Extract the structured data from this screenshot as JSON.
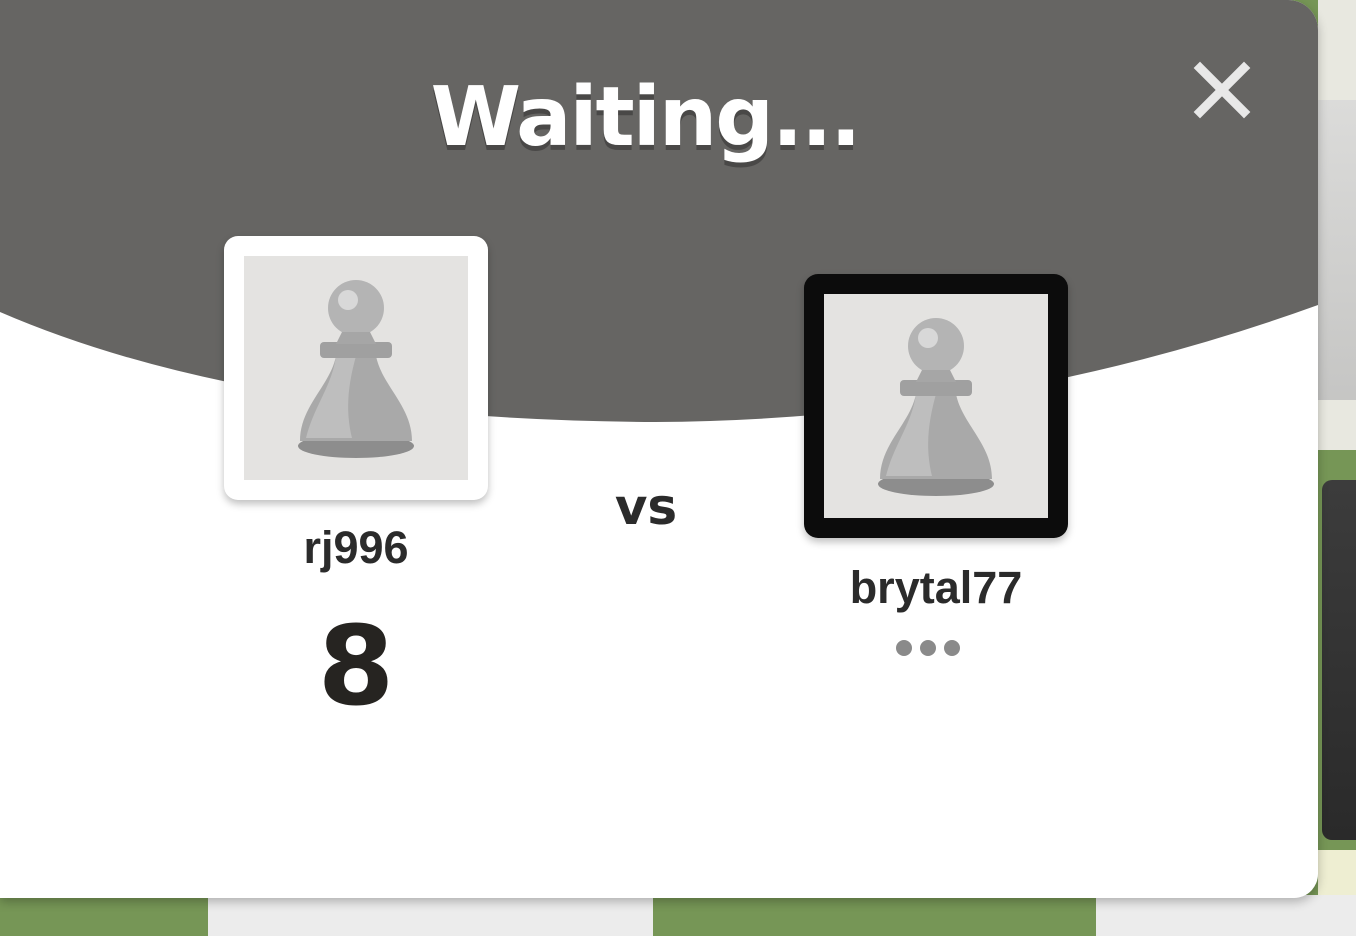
{
  "dialog": {
    "title": "Waiting...",
    "close_icon": "close-icon",
    "header_color": "#666563",
    "versus_label": "vs"
  },
  "players": [
    {
      "name": "rj996",
      "score": "8",
      "piece_color": "white",
      "avatar_icon": "pawn-icon"
    },
    {
      "name": "brytal77",
      "status_icon": "more-dots-icon",
      "piece_color": "black",
      "avatar_icon": "pawn-icon"
    }
  ]
}
